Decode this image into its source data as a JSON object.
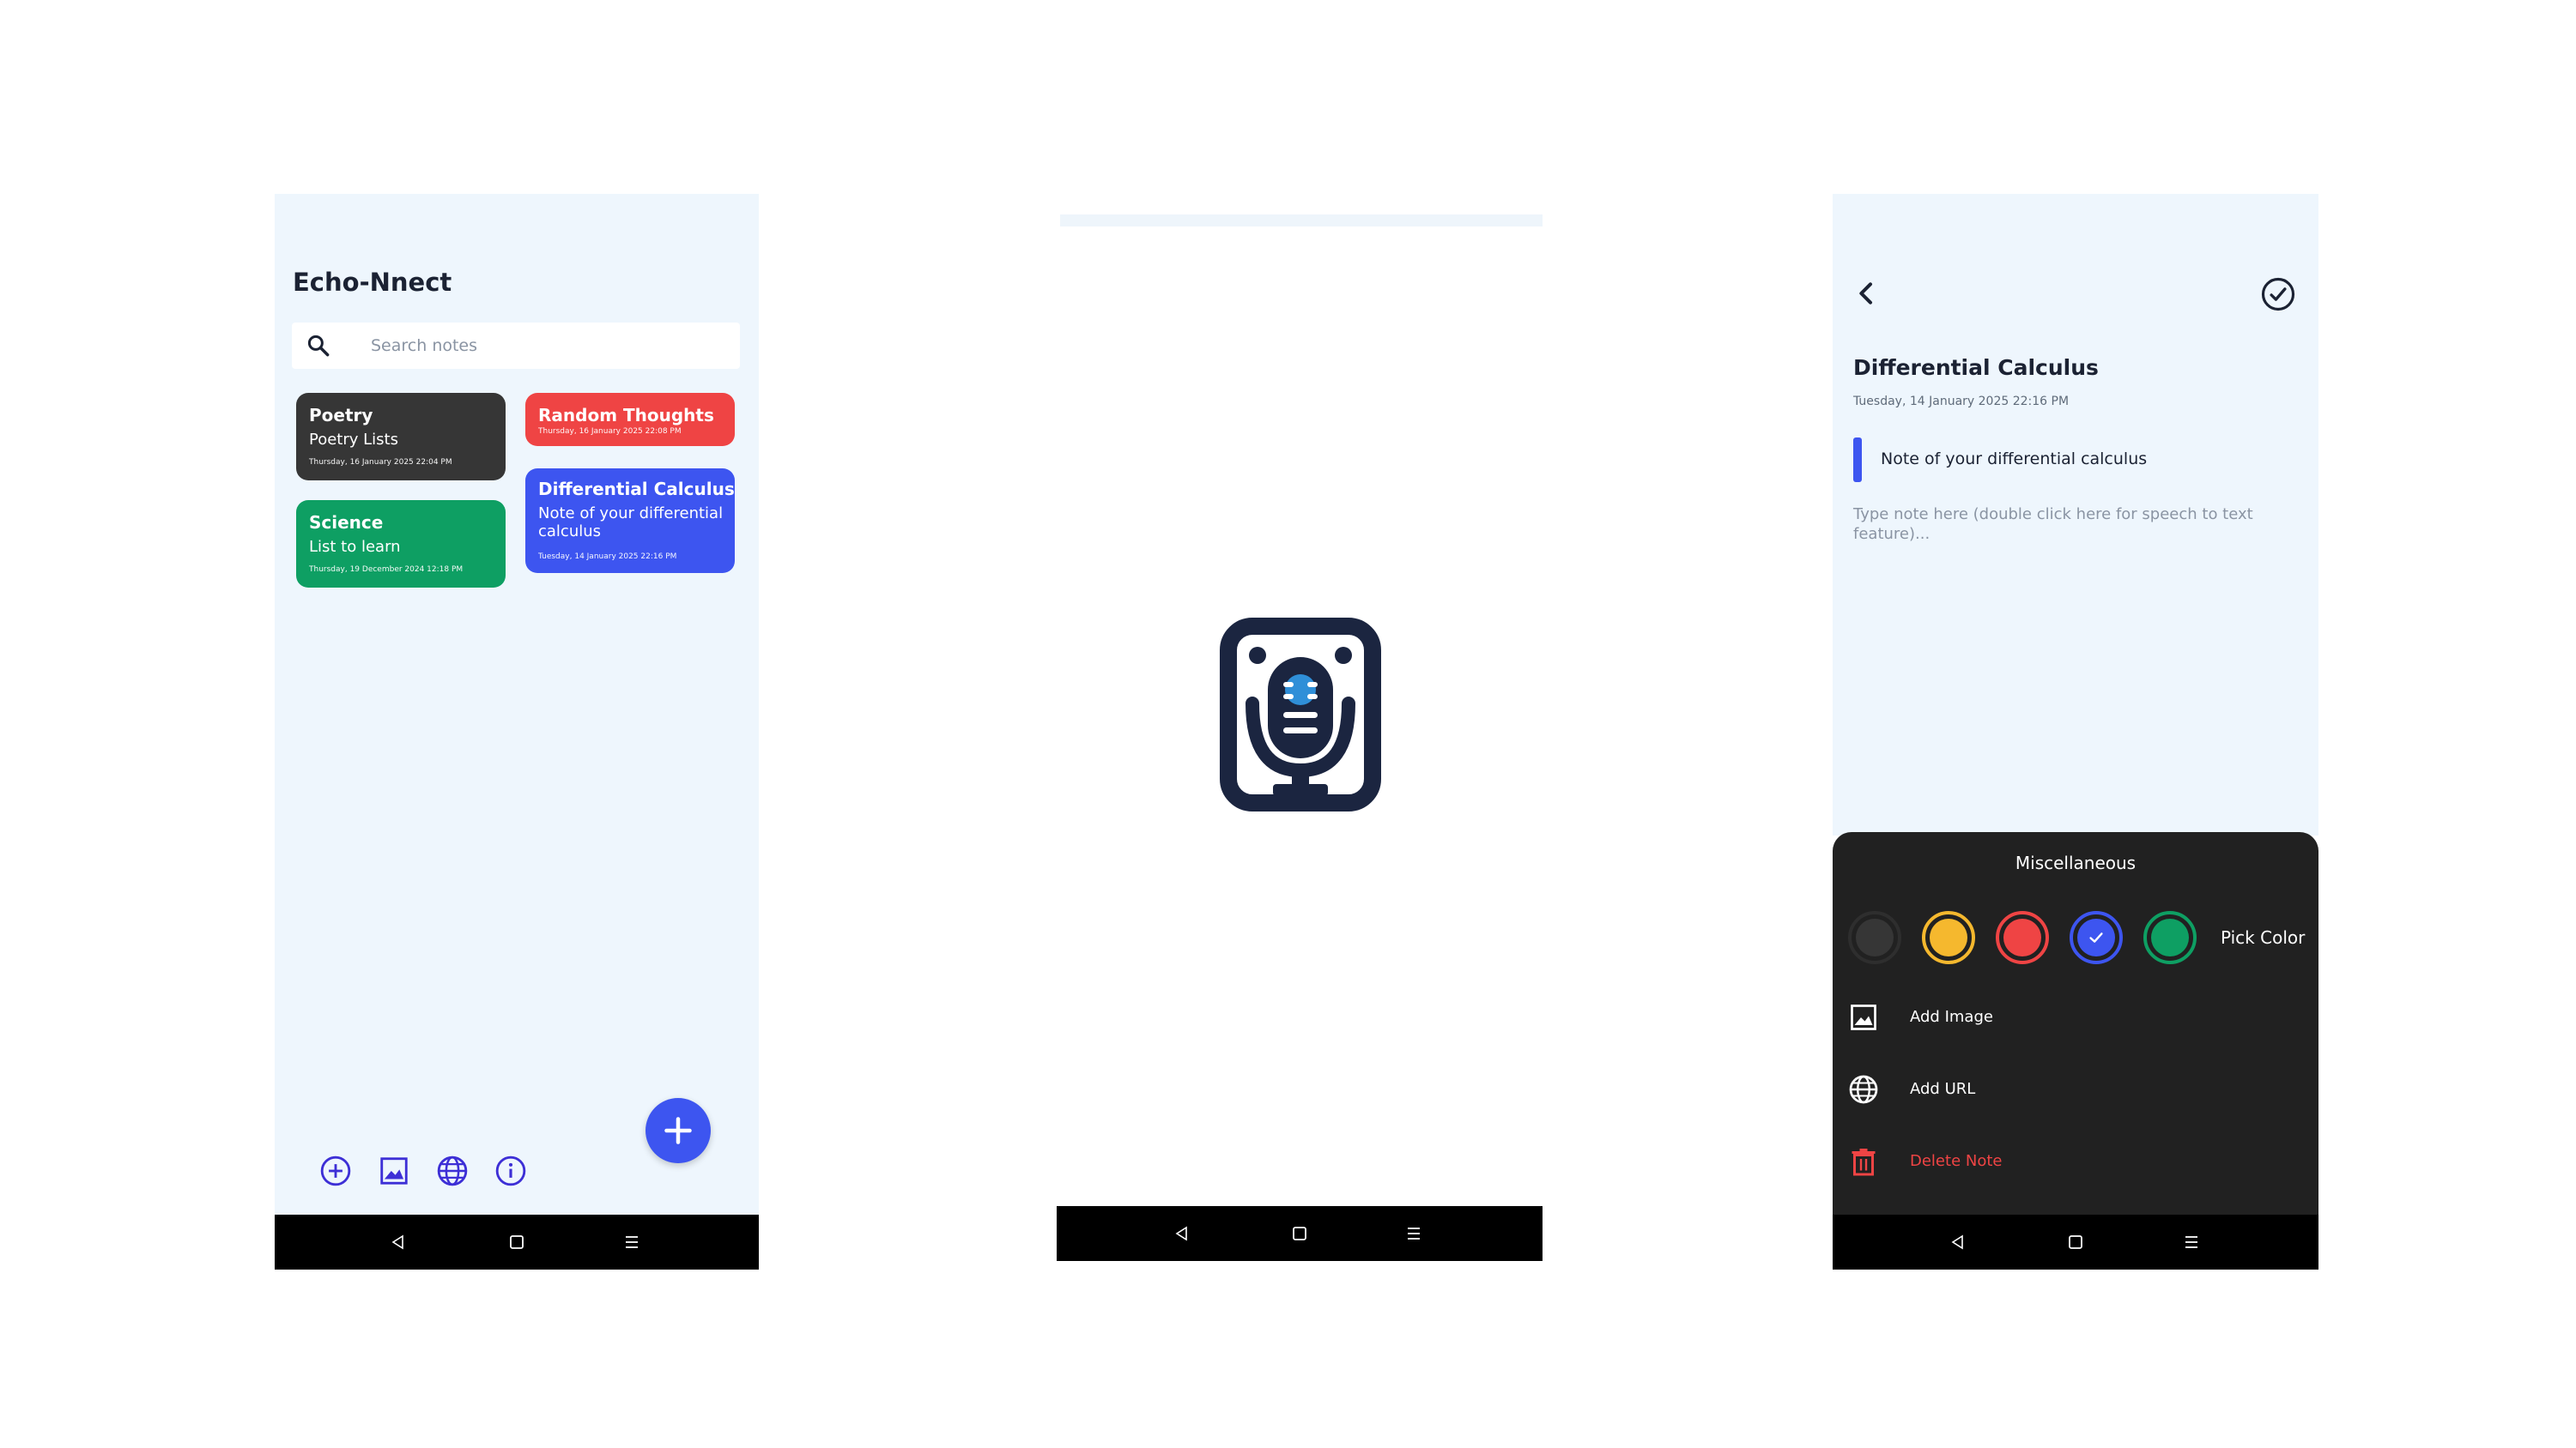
{
  "colors": {
    "screen_bg": "#eef6fd",
    "accent_blue": "#3d55f0",
    "card_dark": "#363636",
    "card_red": "#ef4444",
    "card_green": "#0e9f63",
    "sheet_bg": "#212121",
    "delete_red": "#ef4444",
    "navbar": "#000000"
  },
  "home": {
    "app_title": "Echo-Nnect",
    "search": {
      "placeholder": "Search notes",
      "icon": "search-icon"
    },
    "notes": [
      {
        "title": "Poetry",
        "subtitle": "Poetry Lists",
        "date": "Thursday, 16 January 2025 22:04 PM",
        "color": "#363636"
      },
      {
        "title": "Random Thoughts",
        "subtitle": "",
        "date": "Thursday, 16 January 2025 22:08 PM",
        "color": "#ef4444"
      },
      {
        "title": "Science",
        "subtitle": "List to learn",
        "date": "Thursday, 19 December 2024 12:18 PM",
        "color": "#0e9f63"
      },
      {
        "title": "Differential Calculus",
        "subtitle": "Note of your differential calculus",
        "date": "Tuesday, 14 January 2025 22:16 PM",
        "color": "#3d55f0"
      }
    ],
    "bottom_icons": [
      "add-circle-icon",
      "image-icon",
      "globe-icon",
      "info-icon"
    ],
    "fab_icon": "plus-icon"
  },
  "navbar_icons": [
    "back-triangle-icon",
    "home-square-icon",
    "menu-lines-icon"
  ],
  "splash": {
    "logo_icon": "microphone-logo-icon"
  },
  "editor": {
    "back_icon": "chevron-left-icon",
    "save_icon": "check-circle-icon",
    "title": "Differential Calculus",
    "date": "Tuesday, 14 January 2025 22:16 PM",
    "subtitle": "Note of your differential calculus",
    "body_placeholder": "Type note here (double click here for speech to text feature)...",
    "sheet": {
      "title": "Miscellaneous",
      "swatches": [
        {
          "color": "#363636",
          "selected": false
        },
        {
          "color": "#f5b82e",
          "selected": false
        },
        {
          "color": "#ef4444",
          "selected": false
        },
        {
          "color": "#3d55f0",
          "selected": true
        },
        {
          "color": "#0e9f63",
          "selected": false
        }
      ],
      "pick_color_label": "Pick Color",
      "add_image_label": "Add Image",
      "add_url_label": "Add URL",
      "delete_label": "Delete Note"
    }
  }
}
